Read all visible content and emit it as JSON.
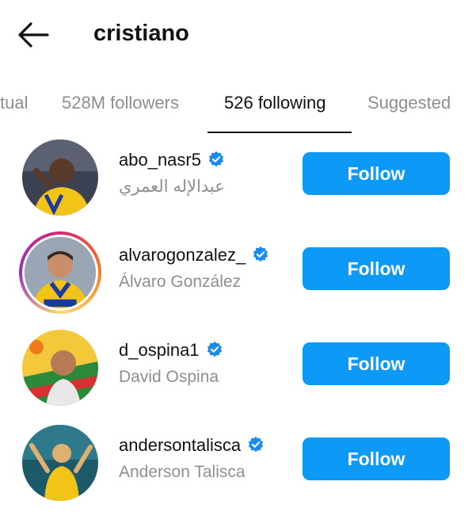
{
  "header": {
    "title": "cristiano",
    "back_icon": "arrow-left-icon"
  },
  "tabs": [
    {
      "label": "tual",
      "active": false
    },
    {
      "label": "528M followers",
      "active": false
    },
    {
      "label": "526 following",
      "active": true
    },
    {
      "label": "Suggested",
      "active": false
    }
  ],
  "users": [
    {
      "username": "abo_nasr5",
      "full_name": "عبدالإله العمري",
      "button": "Follow",
      "verified": true
    },
    {
      "username": "alvarogonzalez_",
      "full_name": "Álvaro González",
      "button": "Follow",
      "verified": true,
      "story_ring": true
    },
    {
      "username": "d_ospina1",
      "full_name": "David Ospina",
      "button": "Follow",
      "verified": true
    },
    {
      "username": "andersontalisca",
      "full_name": "Anderson Talisca",
      "button": "Follow",
      "verified": true
    }
  ],
  "colors": {
    "follow_button": "#0d9af6",
    "verified_badge": "#1a8cf0",
    "secondary_text": "#8e8e8e"
  }
}
